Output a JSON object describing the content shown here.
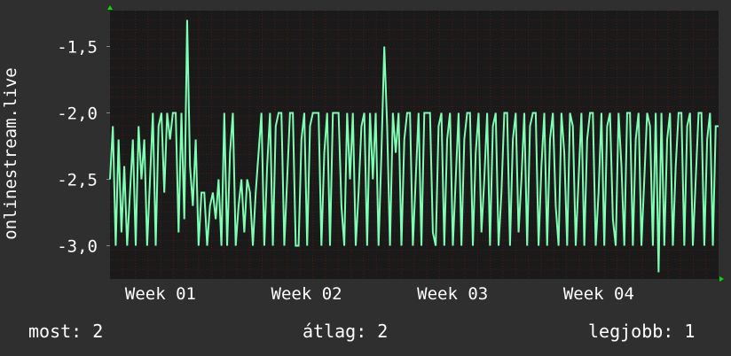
{
  "colors": {
    "background": "#2f2f2f",
    "plot_background": "#1a1a1a",
    "grid": "#4a1a1a",
    "line": "#7dffb4",
    "arrow": "#00dd00"
  },
  "chart_data": {
    "type": "line",
    "ylabel": "onlinestream.live",
    "yticks": [
      -1.5,
      -2.0,
      -2.5,
      -3.0
    ],
    "ytick_labels": [
      "-1,5",
      "-2,0",
      "-2,5",
      "-3,0"
    ],
    "ylim": [
      -3.25,
      -1.23
    ],
    "xlim": [
      0,
      100
    ],
    "xtick_positions": [
      8.3,
      32.3,
      56.3,
      80.3
    ],
    "xtick_labels": [
      "Week 01",
      "Week 02",
      "Week 03",
      "Week 04"
    ],
    "grid": true,
    "series": [
      {
        "values": [
          -2.5,
          -2.1,
          -3.0,
          -2.2,
          -2.9,
          -2.4,
          -3.0,
          -2.6,
          -2.2,
          -3.0,
          -2.1,
          -2.5,
          -2.2,
          -3.0,
          -2.5,
          -2.0,
          -3.0,
          -2.1,
          -2.0,
          -2.6,
          -2.0,
          -2.2,
          -2.0,
          -2.0,
          -2.9,
          -2.0,
          -2.8,
          -1.3,
          -2.4,
          -2.7,
          -2.2,
          -3.0,
          -2.6,
          -2.6,
          -3.0,
          -2.7,
          -2.6,
          -2.8,
          -2.5,
          -3.0,
          -2.0,
          -3.0,
          -2.3,
          -2.0,
          -3.0,
          -2.7,
          -2.5,
          -2.9,
          -2.5,
          -2.6,
          -3.0,
          -2.6,
          -2.3,
          -2.0,
          -3.0,
          -2.4,
          -2.0,
          -3.0,
          -2.1,
          -2.0,
          -2.0,
          -3.0,
          -2.5,
          -2.0,
          -2.0,
          -3.0,
          -3.0,
          -2.2,
          -2.0,
          -3.0,
          -2.1,
          -2.0,
          -2.0,
          -2.0,
          -3.0,
          -2.3,
          -2.0,
          -3.0,
          -2.0,
          -2.0,
          -2.0,
          -2.7,
          -3.0,
          -2.0,
          -2.5,
          -2.0,
          -3.0,
          -2.6,
          -2.1,
          -2.0,
          -3.0,
          -2.0,
          -2.5,
          -2.0,
          -3.0,
          -2.3,
          -1.5,
          -2.1,
          -3.0,
          -2.0,
          -2.3,
          -2.0,
          -3.0,
          -2.2,
          -2.0,
          -2.0,
          -3.0,
          -2.5,
          -2.0,
          -3.0,
          -2.0,
          -2.0,
          -2.0,
          -2.9,
          -3.0,
          -2.1,
          -2.0,
          -3.0,
          -2.2,
          -2.0,
          -3.0,
          -2.5,
          -2.0,
          -3.0,
          -2.2,
          -2.0,
          -2.0,
          -3.0,
          -2.3,
          -2.0,
          -2.9,
          -2.5,
          -2.0,
          -3.0,
          -2.1,
          -2.0,
          -3.0,
          -2.6,
          -2.0,
          -2.0,
          -3.0,
          -2.2,
          -2.0,
          -2.9,
          -2.5,
          -2.0,
          -3.0,
          -2.1,
          -2.0,
          -2.0,
          -3.0,
          -2.4,
          -2.0,
          -3.0,
          -2.2,
          -2.0,
          -2.7,
          -3.0,
          -2.0,
          -2.3,
          -3.0,
          -2.0,
          -2.1,
          -3.0,
          -2.5,
          -2.0,
          -3.0,
          -2.2,
          -2.0,
          -2.0,
          -3.0,
          -2.6,
          -2.0,
          -3.0,
          -2.1,
          -2.0,
          -2.8,
          -3.0,
          -2.0,
          -2.4,
          -3.0,
          -2.0,
          -2.0,
          -3.0,
          -2.2,
          -2.0,
          -3.0,
          -2.5,
          -2.0,
          -2.1,
          -3.0,
          -2.0,
          -3.2,
          -2.0,
          -3.0,
          -2.2,
          -2.0,
          -3.0,
          -2.4,
          -2.0,
          -2.0,
          -3.0,
          -2.1,
          -2.0,
          -3.0,
          -2.5,
          -2.0,
          -2.0,
          -3.0,
          -2.2,
          -2.0,
          -3.0,
          -2.1,
          -2.1
        ]
      }
    ]
  },
  "stats": {
    "now": "most: 2",
    "avg": "átlag: 2",
    "best": "legjobb: 1"
  }
}
